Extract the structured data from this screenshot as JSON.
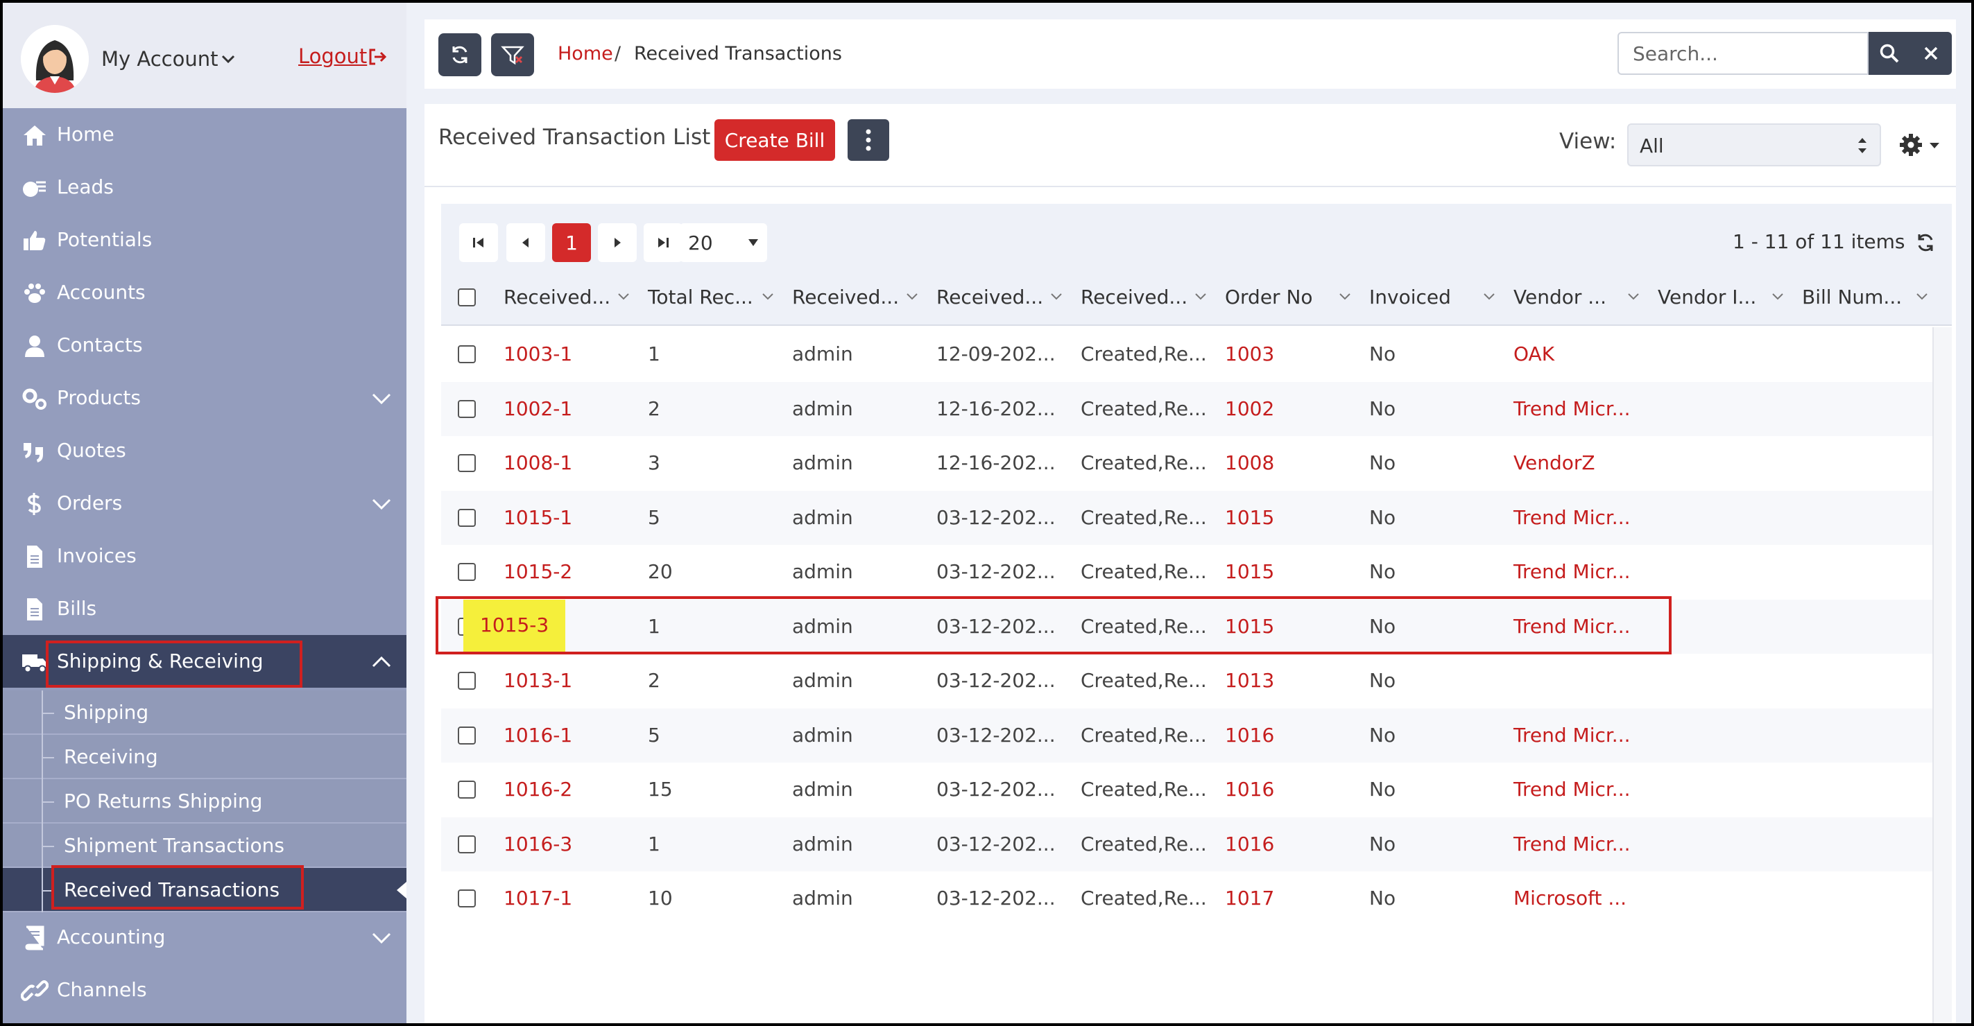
{
  "account": {
    "label": "My Account",
    "logout": "Logout"
  },
  "nav": {
    "items": [
      {
        "label": "Home",
        "icon": "home-icon"
      },
      {
        "label": "Leads",
        "icon": "leads-icon"
      },
      {
        "label": "Potentials",
        "icon": "thumbs-up-icon"
      },
      {
        "label": "Accounts",
        "icon": "paw-icon"
      },
      {
        "label": "Contacts",
        "icon": "person-icon"
      },
      {
        "label": "Products",
        "icon": "gears-icon"
      },
      {
        "label": "Quotes",
        "icon": "quote-icon"
      },
      {
        "label": "Orders",
        "icon": "dollar-icon"
      },
      {
        "label": "Invoices",
        "icon": "document-icon"
      },
      {
        "label": "Bills",
        "icon": "document-icon"
      },
      {
        "label": "Shipping & Receiving",
        "icon": "truck-icon"
      }
    ],
    "sub_items": [
      {
        "label": "Shipping"
      },
      {
        "label": "Receiving"
      },
      {
        "label": "PO Returns Shipping"
      },
      {
        "label": "Shipment Transactions"
      },
      {
        "label": "Received Transactions"
      }
    ],
    "after_items": [
      {
        "label": "Accounting",
        "icon": "book-icon"
      },
      {
        "label": "Channels",
        "icon": "link-icon"
      }
    ]
  },
  "breadcrumb": {
    "home": "Home",
    "separator": "/",
    "current": "Received Transactions"
  },
  "search": {
    "placeholder": "Search..."
  },
  "panel": {
    "title": "Received Transaction List",
    "create_button": "Create Bill",
    "view_label": "View:",
    "view_value": "All"
  },
  "pager": {
    "current_page": "1",
    "page_size": "20",
    "count": "1 - 11 of 11 items"
  },
  "grid": {
    "columns": [
      "Received...",
      "Total Rec...",
      "Received...",
      "Received...",
      "Received...",
      "Order No",
      "Invoiced",
      "Vendor ...",
      "Vendor I...",
      "Bill Num..."
    ],
    "rows": [
      {
        "id": "1003-1",
        "total": "1",
        "by": "admin",
        "date": "12-09-202...",
        "status": "Created,Re...",
        "order": "1003",
        "invoiced": "No",
        "vendor": "OAK"
      },
      {
        "id": "1002-1",
        "total": "2",
        "by": "admin",
        "date": "12-16-202...",
        "status": "Created,Re...",
        "order": "1002",
        "invoiced": "No",
        "vendor": "Trend Micr..."
      },
      {
        "id": "1008-1",
        "total": "3",
        "by": "admin",
        "date": "12-16-202...",
        "status": "Created,Re...",
        "order": "1008",
        "invoiced": "No",
        "vendor": "VendorZ"
      },
      {
        "id": "1015-1",
        "total": "5",
        "by": "admin",
        "date": "03-12-202...",
        "status": "Created,Re...",
        "order": "1015",
        "invoiced": "No",
        "vendor": "Trend Micr..."
      },
      {
        "id": "1015-2",
        "total": "20",
        "by": "admin",
        "date": "03-12-202...",
        "status": "Created,Re...",
        "order": "1015",
        "invoiced": "No",
        "vendor": "Trend Micr..."
      },
      {
        "id": "1015-3",
        "total": "1",
        "by": "admin",
        "date": "03-12-202...",
        "status": "Created,Re...",
        "order": "1015",
        "invoiced": "No",
        "vendor": "Trend Micr..."
      },
      {
        "id": "1013-1",
        "total": "2",
        "by": "admin",
        "date": "03-12-202...",
        "status": "Created,Re...",
        "order": "1013",
        "invoiced": "No",
        "vendor": ""
      },
      {
        "id": "1016-1",
        "total": "5",
        "by": "admin",
        "date": "03-12-202...",
        "status": "Created,Re...",
        "order": "1016",
        "invoiced": "No",
        "vendor": "Trend Micr..."
      },
      {
        "id": "1016-2",
        "total": "15",
        "by": "admin",
        "date": "03-12-202...",
        "status": "Created,Re...",
        "order": "1016",
        "invoiced": "No",
        "vendor": "Trend Micr..."
      },
      {
        "id": "1016-3",
        "total": "1",
        "by": "admin",
        "date": "03-12-202...",
        "status": "Created,Re...",
        "order": "1016",
        "invoiced": "No",
        "vendor": "Trend Micr..."
      },
      {
        "id": "1017-1",
        "total": "10",
        "by": "admin",
        "date": "03-12-202...",
        "status": "Created,Re...",
        "order": "1017",
        "invoiced": "No",
        "vendor": "Microsoft ..."
      }
    ]
  },
  "colors": {
    "accent": "#d42a2a",
    "link": "#c51d1d",
    "sidebar": "#949dbd",
    "sidebar_active": "#3b4462",
    "dark_button": "#3d4556",
    "highlight": "#f5ef3b"
  }
}
